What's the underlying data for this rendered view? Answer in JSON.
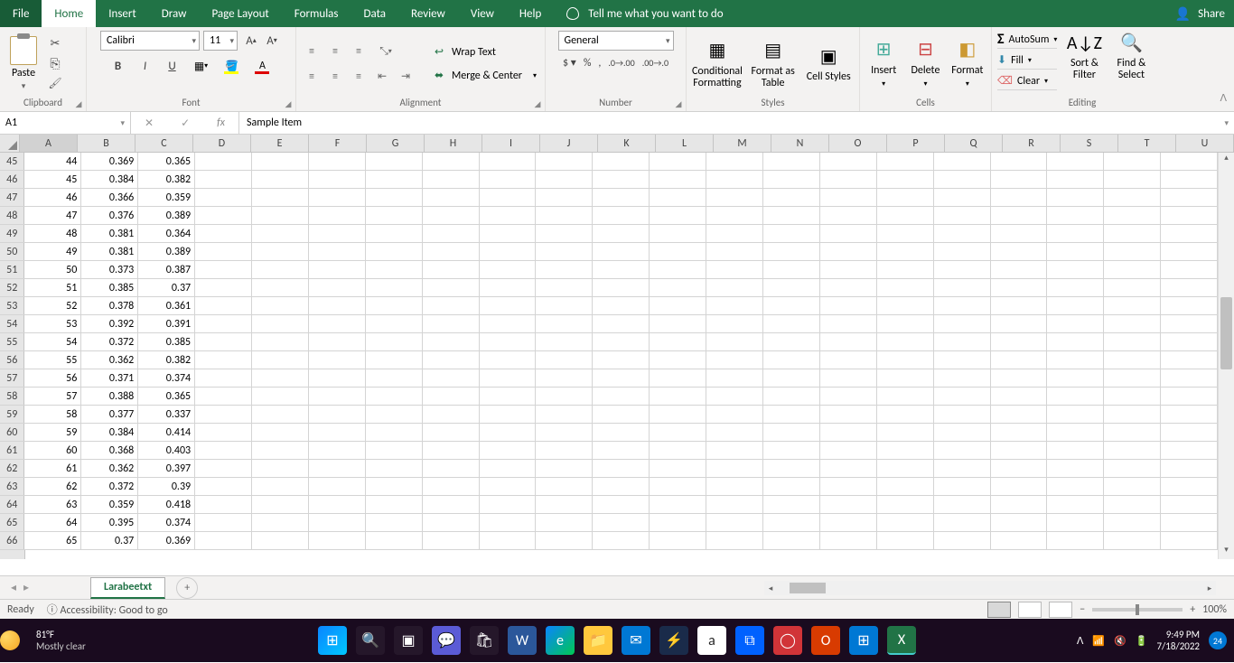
{
  "tabs": {
    "file": "File",
    "home": "Home",
    "insert": "Insert",
    "draw": "Draw",
    "pagelayout": "Page Layout",
    "formulas": "Formulas",
    "data": "Data",
    "review": "Review",
    "view": "View",
    "help": "Help",
    "tellme": "Tell me what you want to do",
    "share": "Share"
  },
  "ribbon": {
    "clipboard": {
      "paste": "Paste",
      "label": "Clipboard"
    },
    "font": {
      "name": "Calibri",
      "size": "11",
      "label": "Font"
    },
    "alignment": {
      "wrap": "Wrap Text",
      "merge": "Merge & Center",
      "label": "Alignment"
    },
    "number": {
      "format": "General",
      "label": "Number"
    },
    "styles": {
      "cond": "Conditional Formatting",
      "table": "Format as Table",
      "cell": "Cell Styles",
      "label": "Styles"
    },
    "cells": {
      "insert": "Insert",
      "delete": "Delete",
      "format": "Format",
      "label": "Cells"
    },
    "editing": {
      "autosum": "AutoSum",
      "fill": "Fill",
      "clear": "Clear",
      "sort": "Sort & Filter",
      "find": "Find & Select",
      "label": "Editing"
    }
  },
  "nameBox": "A1",
  "formula": "Sample Item",
  "columns": [
    "A",
    "B",
    "C",
    "D",
    "E",
    "F",
    "G",
    "H",
    "I",
    "J",
    "K",
    "L",
    "M",
    "N",
    "O",
    "P",
    "Q",
    "R",
    "S",
    "T",
    "U"
  ],
  "rows": [
    {
      "n": 45,
      "a": "44",
      "b": "0.369",
      "c": "0.365"
    },
    {
      "n": 46,
      "a": "45",
      "b": "0.384",
      "c": "0.382"
    },
    {
      "n": 47,
      "a": "46",
      "b": "0.366",
      "c": "0.359"
    },
    {
      "n": 48,
      "a": "47",
      "b": "0.376",
      "c": "0.389"
    },
    {
      "n": 49,
      "a": "48",
      "b": "0.381",
      "c": "0.364"
    },
    {
      "n": 50,
      "a": "49",
      "b": "0.381",
      "c": "0.389"
    },
    {
      "n": 51,
      "a": "50",
      "b": "0.373",
      "c": "0.387"
    },
    {
      "n": 52,
      "a": "51",
      "b": "0.385",
      "c": "0.37"
    },
    {
      "n": 53,
      "a": "52",
      "b": "0.378",
      "c": "0.361"
    },
    {
      "n": 54,
      "a": "53",
      "b": "0.392",
      "c": "0.391"
    },
    {
      "n": 55,
      "a": "54",
      "b": "0.372",
      "c": "0.385"
    },
    {
      "n": 56,
      "a": "55",
      "b": "0.362",
      "c": "0.382"
    },
    {
      "n": 57,
      "a": "56",
      "b": "0.371",
      "c": "0.374"
    },
    {
      "n": 58,
      "a": "57",
      "b": "0.388",
      "c": "0.365"
    },
    {
      "n": 59,
      "a": "58",
      "b": "0.377",
      "c": "0.337"
    },
    {
      "n": 60,
      "a": "59",
      "b": "0.384",
      "c": "0.414"
    },
    {
      "n": 61,
      "a": "60",
      "b": "0.368",
      "c": "0.403"
    },
    {
      "n": 62,
      "a": "61",
      "b": "0.362",
      "c": "0.397"
    },
    {
      "n": 63,
      "a": "62",
      "b": "0.372",
      "c": "0.39"
    },
    {
      "n": 64,
      "a": "63",
      "b": "0.359",
      "c": "0.418"
    },
    {
      "n": 65,
      "a": "64",
      "b": "0.395",
      "c": "0.374"
    },
    {
      "n": 66,
      "a": "65",
      "b": "0.37",
      "c": "0.369"
    }
  ],
  "sheet": {
    "name": "Larabeetxt"
  },
  "status": {
    "ready": "Ready",
    "accessibility": "Accessibility: Good to go",
    "zoom": "100%"
  },
  "taskbar": {
    "temp": "81°F",
    "weather": "Mostly clear",
    "time": "9:49 PM",
    "date": "7/18/2022",
    "notif": "24"
  }
}
